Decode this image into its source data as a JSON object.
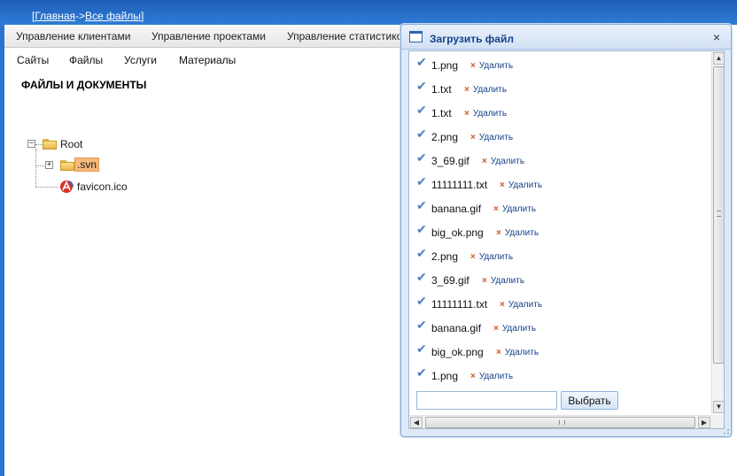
{
  "breadcrumb": {
    "open": "[",
    "home": "Главная",
    "sep": "->",
    "current": "Все файлы",
    "close": "]"
  },
  "menu": [
    {
      "label": "Управление клиентами"
    },
    {
      "label": "Управление проектами"
    },
    {
      "label": "Управление статистико"
    }
  ],
  "submenu": [
    {
      "label": "Сайты"
    },
    {
      "label": "Файлы"
    },
    {
      "label": "Услуги"
    },
    {
      "label": "Материалы"
    }
  ],
  "page": {
    "heading": "ФАЙЛЫ И ДОКУМЕНТЫ"
  },
  "tree": {
    "root_label": "Root",
    "root_toggle": "−",
    "svn_label": ".svn",
    "svn_toggle": "+",
    "favicon_label": "favicon.ico"
  },
  "dialog": {
    "title": "Загрузить файл",
    "close_glyph": "×",
    "delete_label": "Удалить",
    "delete_glyph": "×",
    "check_glyph": "✔",
    "files": [
      {
        "name": "1.png"
      },
      {
        "name": "1.txt"
      },
      {
        "name": "1.txt"
      },
      {
        "name": "2.png"
      },
      {
        "name": "3_69.gif"
      },
      {
        "name": "11111111.txt"
      },
      {
        "name": "banana.gif"
      },
      {
        "name": "big_ok.png"
      },
      {
        "name": "2.png"
      },
      {
        "name": "3_69.gif"
      },
      {
        "name": "11111111.txt"
      },
      {
        "name": "banana.gif"
      },
      {
        "name": "big_ok.png"
      },
      {
        "name": "1.png"
      }
    ],
    "input_value": "",
    "choose_label": "Выбрать"
  },
  "scrollbar": {
    "up": "▲",
    "down": "▼",
    "left": "◀",
    "right": "▶"
  },
  "colors": {
    "accent": "#2a74cf",
    "dialog_title": "#15428b",
    "delete_x": "#d2571b",
    "check": "#4a7fc0",
    "selected_bg": "#f4b97a"
  }
}
